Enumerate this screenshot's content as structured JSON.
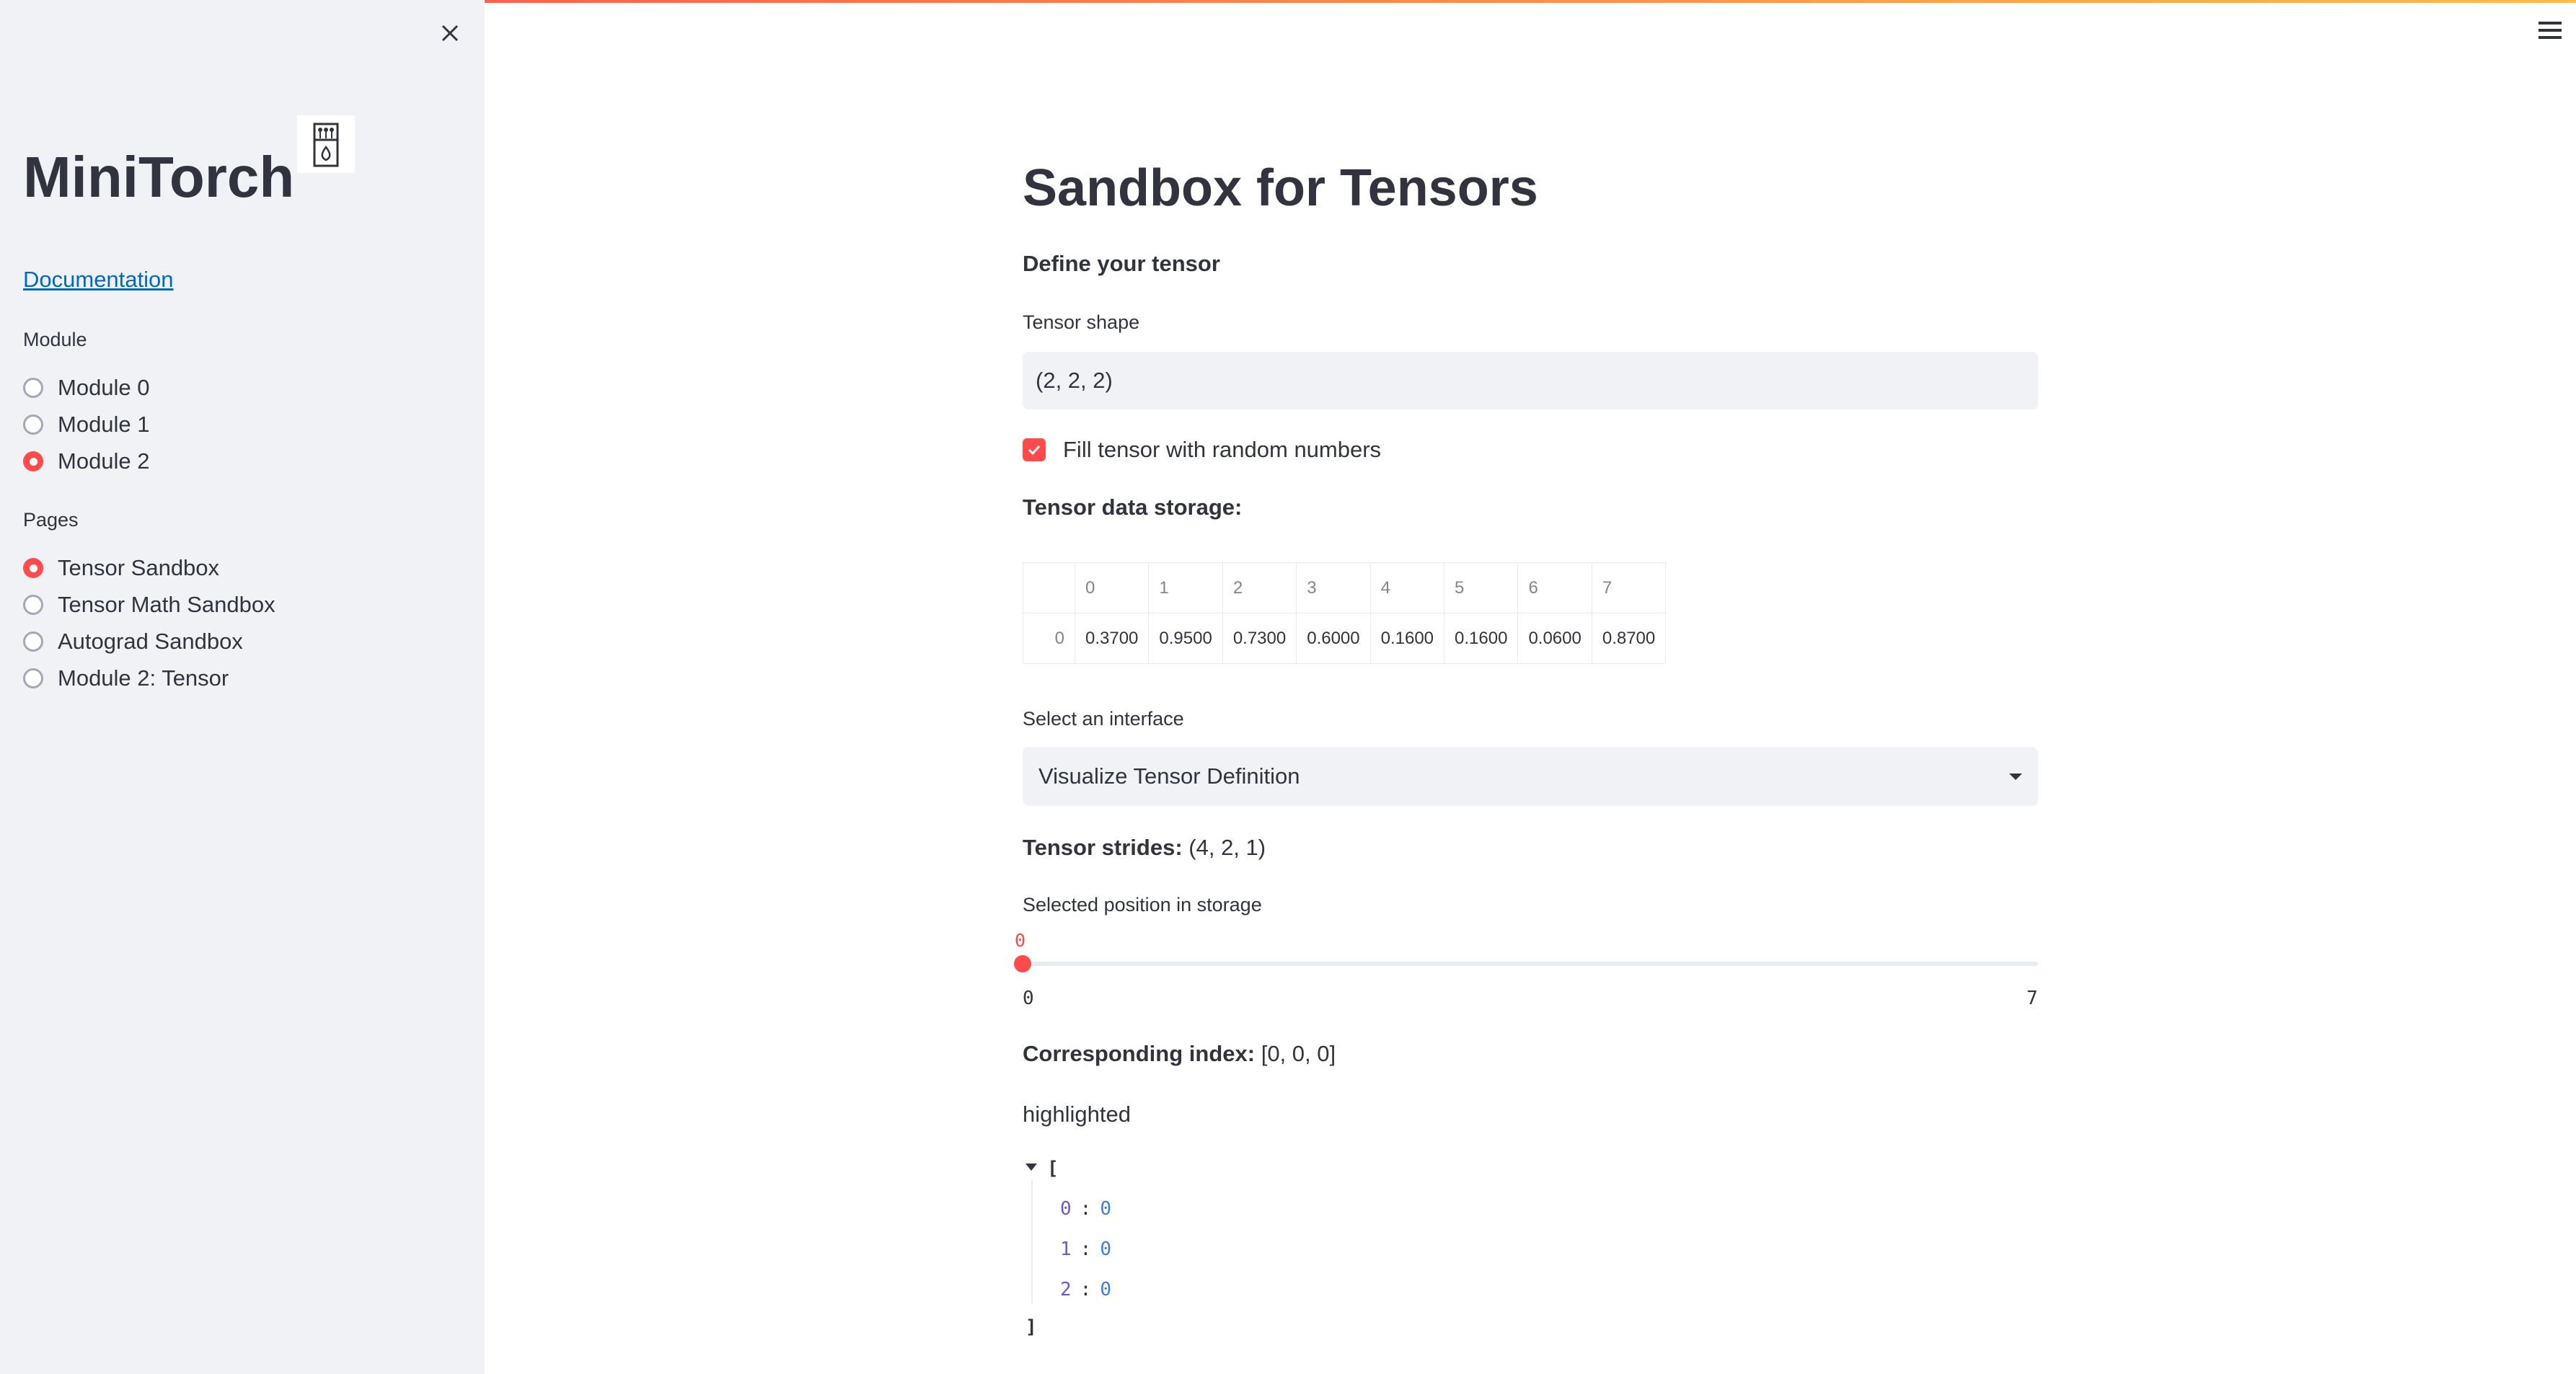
{
  "sidebar": {
    "title": "MiniTorch",
    "doc_link": "Documentation",
    "module_label": "Module",
    "modules": [
      {
        "label": "Module 0",
        "selected": false
      },
      {
        "label": "Module 1",
        "selected": false
      },
      {
        "label": "Module 2",
        "selected": true
      }
    ],
    "pages_label": "Pages",
    "pages": [
      {
        "label": "Tensor Sandbox",
        "selected": true
      },
      {
        "label": "Tensor Math Sandbox",
        "selected": false
      },
      {
        "label": "Autograd Sandbox",
        "selected": false
      },
      {
        "label": "Module 2: Tensor",
        "selected": false
      }
    ]
  },
  "main": {
    "title": "Sandbox for Tensors",
    "define_heading": "Define your tensor",
    "shape_label": "Tensor shape",
    "shape_value": "(2, 2, 2)",
    "random_checkbox_label": "Fill tensor with random numbers",
    "random_checked": true,
    "storage_heading": "Tensor data storage:",
    "storage_table": {
      "columns": [
        "0",
        "1",
        "2",
        "3",
        "4",
        "5",
        "6",
        "7"
      ],
      "row_index": "0",
      "values": [
        "0.3700",
        "0.9500",
        "0.7300",
        "0.6000",
        "0.1600",
        "0.1600",
        "0.0600",
        "0.8700"
      ]
    },
    "interface_label": "Select an interface",
    "interface_value": "Visualize Tensor Definition",
    "strides_label": "Tensor strides:",
    "strides_value": "(4, 2, 1)",
    "position_label": "Selected position in storage",
    "slider": {
      "value": "0",
      "min": "0",
      "max": "7"
    },
    "index_label": "Corresponding index:",
    "index_value": "[0, 0, 0]",
    "highlighted_label": "highlighted",
    "json_open": "[",
    "json_close": "]",
    "highlighted": [
      {
        "key": "0",
        "value": "0"
      },
      {
        "key": "1",
        "value": "0"
      },
      {
        "key": "2",
        "value": "0"
      }
    ]
  },
  "colors": {
    "accent": "#ff4b4b",
    "sidebar_bg": "#f0f2f6",
    "text": "#31333f",
    "link": "#0068c9"
  }
}
